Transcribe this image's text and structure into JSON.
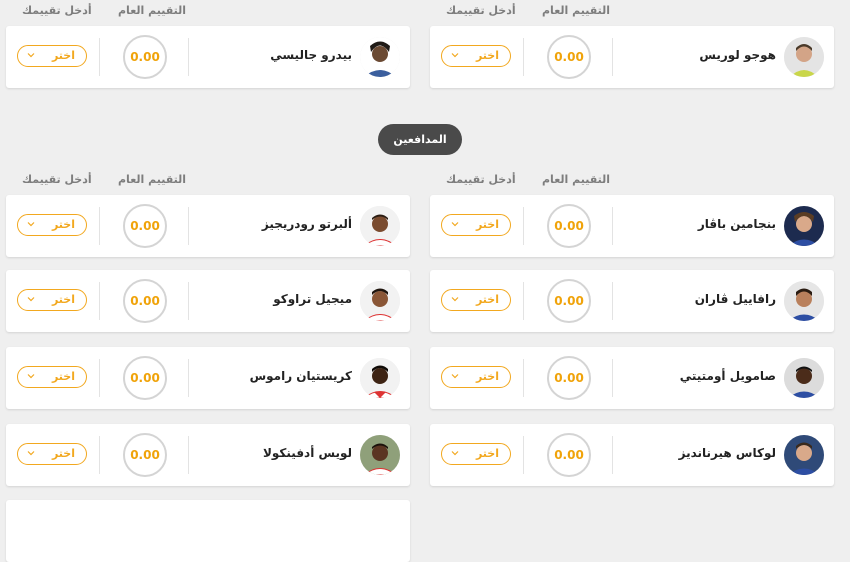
{
  "columns": {
    "overall": "التقييم العام",
    "rate": "أدخل تقييمك"
  },
  "section": {
    "defenders_label": "المدافعين"
  },
  "select": {
    "placeholder": "اختر"
  },
  "score_default": "0.00",
  "colors": {
    "accent": "#f2a81f",
    "score": "#f0a30a",
    "pill": "#4a4a4a"
  },
  "players": {
    "goalkeepers": [
      {
        "name": "هوجو لوريس",
        "score": "0.00",
        "select": "اختر"
      },
      {
        "name": "بيدرو جاليسي",
        "score": "0.00",
        "select": "اختر"
      }
    ],
    "defenders": [
      {
        "name": "بنجامين باڤار",
        "score": "0.00",
        "select": "اختر"
      },
      {
        "name": "ألبرتو رودريجيز",
        "score": "0.00",
        "select": "اختر"
      },
      {
        "name": "رافاييل ڤاران",
        "score": "0.00",
        "select": "اختر"
      },
      {
        "name": "ميجيل تراوكو",
        "score": "0.00",
        "select": "اختر"
      },
      {
        "name": "صامويل أومتيتي",
        "score": "0.00",
        "select": "اختر"
      },
      {
        "name": "كريستيان راموس",
        "score": "0.00",
        "select": "اختر"
      },
      {
        "name": "لوكاس هيرنانديز",
        "score": "0.00",
        "select": "اختر"
      },
      {
        "name": "لويس أدفينكولا",
        "score": "0.00",
        "select": "اختر"
      }
    ]
  }
}
